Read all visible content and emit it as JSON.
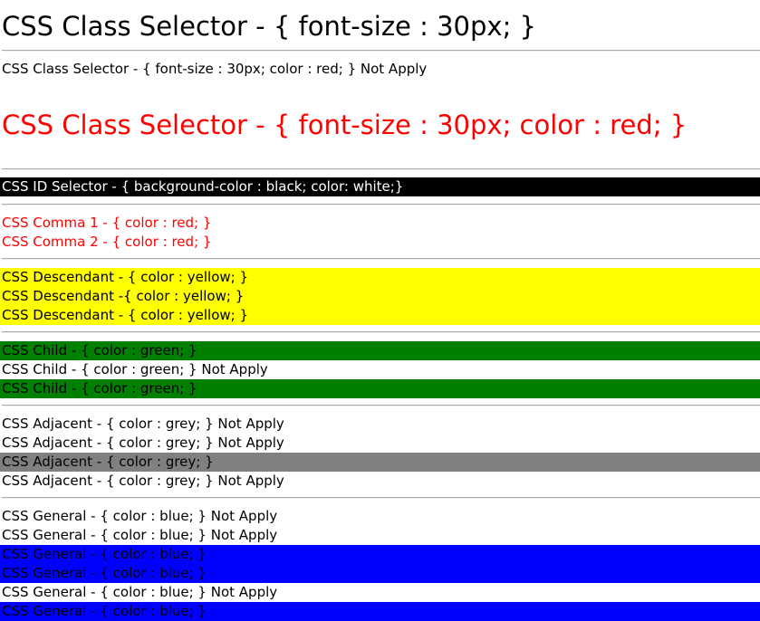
{
  "heading_class": "CSS Class Selector - { font-size : 30px; }",
  "class_not_apply": "CSS Class Selector - { font-size : 30px; color : red; } Not Apply",
  "class_red": "CSS Class Selector - { font-size : 30px; color : red; }",
  "id_selector": "CSS ID Selector - { background-color : black; color: white;}",
  "comma": [
    "CSS Comma 1 - { color : red; }",
    "CSS Comma 2 - { color : red; }"
  ],
  "descendant": [
    "CSS Descendant - { color : yellow; }",
    "CSS Descendant -{ color : yellow; }",
    "CSS Descendant - { color : yellow; }"
  ],
  "child": [
    "CSS Child - { color : green; }",
    "CSS Child - { color : green; } Not Apply",
    "CSS Child - { color : green; }"
  ],
  "adjacent": [
    "CSS Adjacent - { color : grey; } Not Apply",
    "CSS Adjacent - { color : grey; } Not Apply",
    "CSS Adjacent - { color : grey; }",
    "CSS Adjacent - { color : grey; } Not Apply"
  ],
  "general": [
    "CSS General - { color : blue; } Not Apply",
    "CSS General - { color : blue; } Not Apply",
    "CSS General - { color : blue; }",
    "CSS General - { color : blue; }",
    "CSS General - { color : blue; } Not Apply",
    "CSS General - { color : blue; }"
  ],
  "colors": {
    "red": "#ff0000",
    "black": "#000000",
    "yellow": "#ffff00",
    "green": "#008000",
    "grey": "#808080",
    "blue": "#0000ff"
  }
}
